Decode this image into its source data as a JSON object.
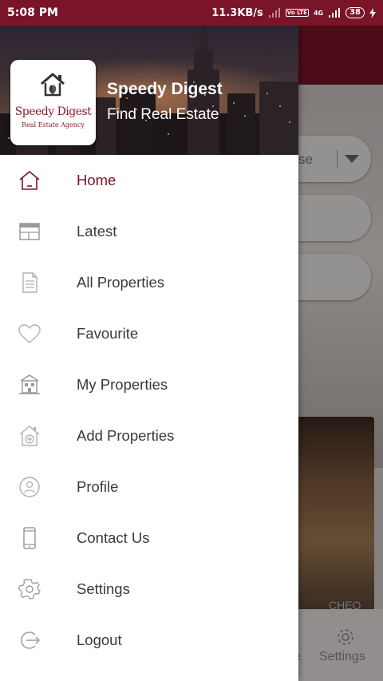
{
  "status_bar": {
    "time": "5:08 PM",
    "network_speed": "11.3KB/s",
    "volte_label": "Vo LTE",
    "network_type": "4G",
    "battery": "38"
  },
  "drawer": {
    "header": {
      "logo_title": "Speedy Digest",
      "logo_subtitle": "Real Estate Agency",
      "app_name": "Speedy Digest",
      "tagline": "Find Real Estate"
    },
    "menu": [
      {
        "label": "Home",
        "icon": "home-icon",
        "active": true
      },
      {
        "label": "Latest",
        "icon": "calendar-icon",
        "active": false
      },
      {
        "label": "All Properties",
        "icon": "document-icon",
        "active": false
      },
      {
        "label": "Favourite",
        "icon": "heart-icon",
        "active": false
      },
      {
        "label": "My Properties",
        "icon": "building-icon",
        "active": false
      },
      {
        "label": "Add Properties",
        "icon": "add-home-icon",
        "active": false
      },
      {
        "label": "Profile",
        "icon": "profile-icon",
        "active": false
      },
      {
        "label": "Contact Us",
        "icon": "phone-icon",
        "active": false
      },
      {
        "label": "Settings",
        "icon": "gear-icon",
        "active": false
      },
      {
        "label": "Logout",
        "icon": "logout-icon",
        "active": false
      }
    ]
  },
  "background_app": {
    "select_partial_text": "se",
    "card_partial_text": "CHEO",
    "bottom_nav_partial": "e",
    "bottom_nav_settings": "Settings"
  },
  "colors": {
    "brand": "#7a1428",
    "menu_text": "#3a3a3a",
    "icon_gray": "#a8a8a8"
  }
}
